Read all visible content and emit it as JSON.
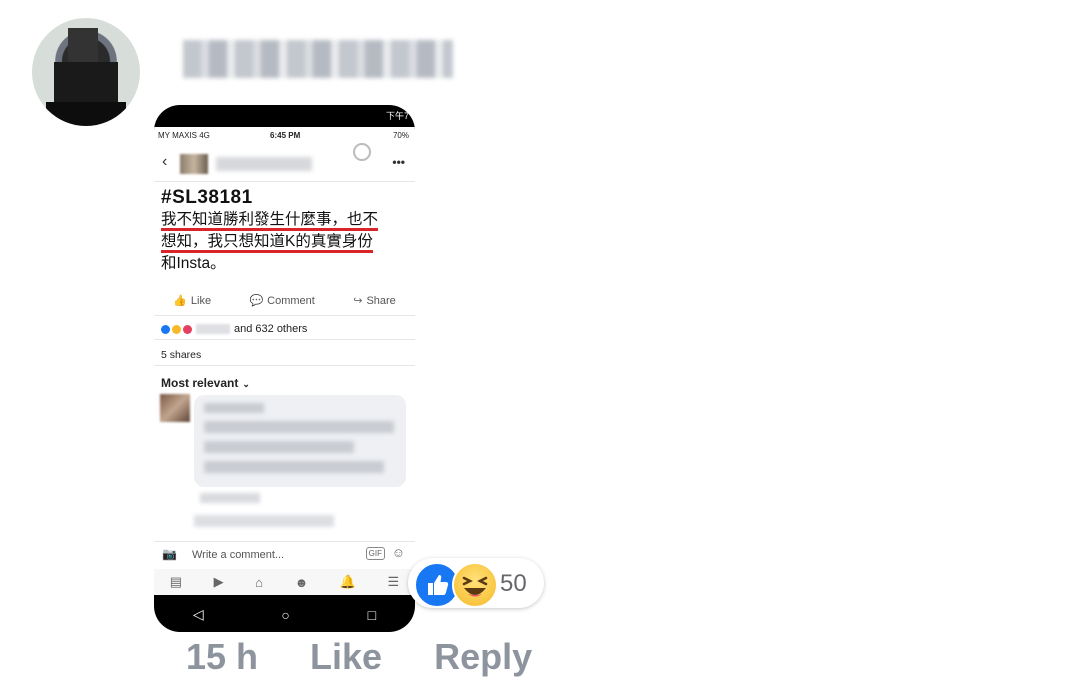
{
  "comment": {
    "time": "15 h",
    "like_label": "Like",
    "reply_label": "Reply",
    "reactions": {
      "icons": [
        "like-icon",
        "haha-icon"
      ],
      "count": "50"
    }
  },
  "phone_screenshot": {
    "status": {
      "carrier": "MY MAXIS 4G",
      "time": "6:45 PM",
      "battery": "70%",
      "android_status_right": "下午7"
    },
    "post": {
      "hashtag": "#SL38181",
      "lines": [
        "我不知道勝利發生什麼事，也不",
        "想知，我只想知道K的真實身份",
        "和Insta。"
      ]
    },
    "actions": {
      "like": "Like",
      "comment": "Comment",
      "share": "Share"
    },
    "reactions_summary": "and 632 others",
    "shares": "5 shares",
    "sort_label": "Most relevant",
    "composer_placeholder": "Write a comment...",
    "gif_label": "GIF",
    "colors": {
      "underline": "#d9252a",
      "like_blue": "#1877f2"
    }
  }
}
